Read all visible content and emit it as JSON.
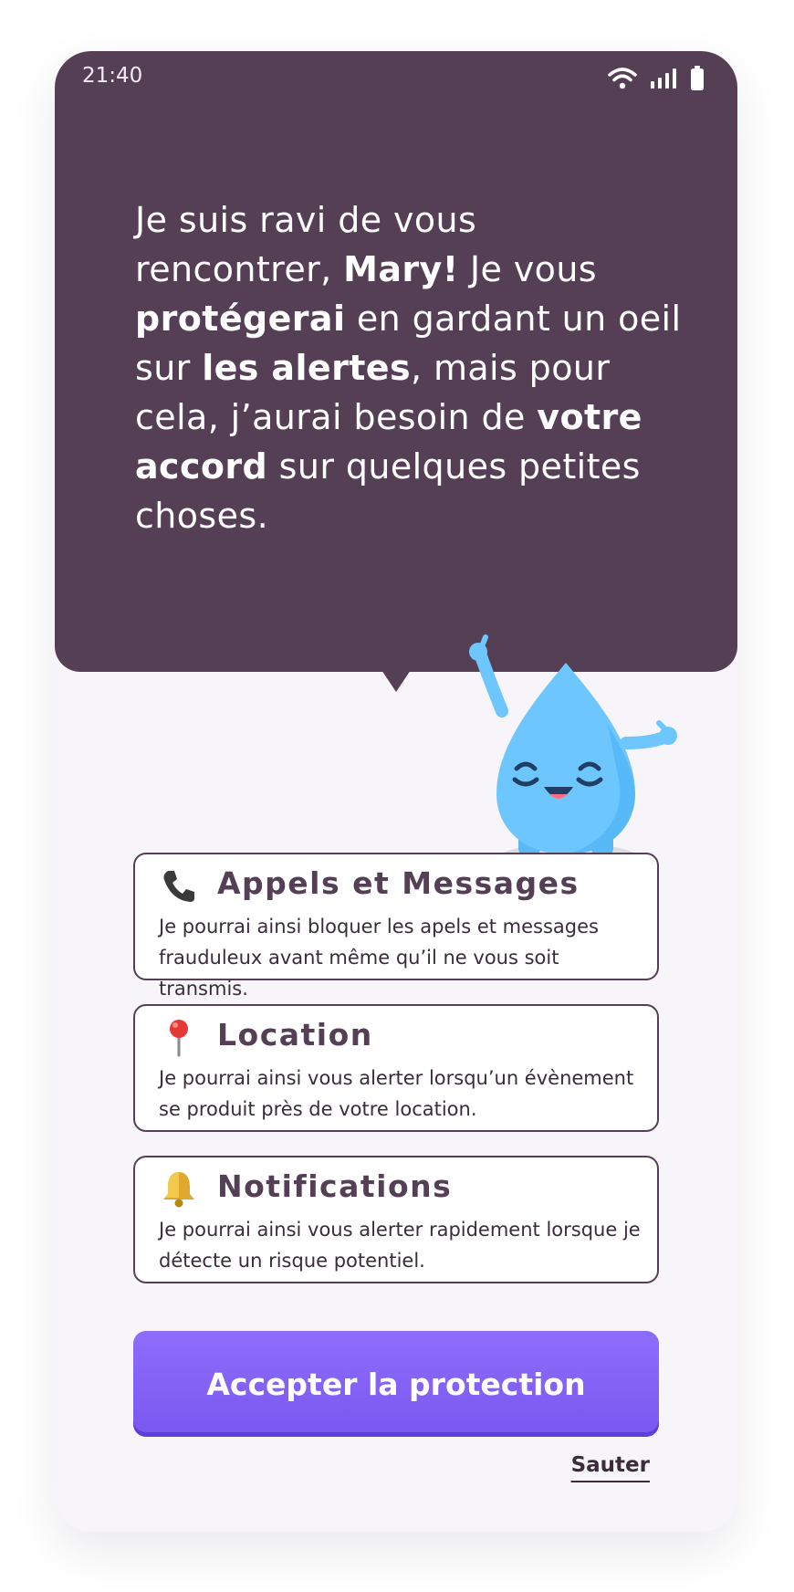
{
  "status_bar": {
    "time": "21:40",
    "icons": [
      "wifi-icon",
      "signal-icon",
      "battery-icon"
    ]
  },
  "intro": {
    "p1": "Je suis ravi de vous rencontrer, ",
    "name": "Mary!",
    "p2": " Je vous ",
    "b1": "protégerai",
    "p3": " en gardant un oeil sur ",
    "b2": "les alertes",
    "p4": ", mais pour cela, j’aurai besoin de ",
    "b3": "votre accord",
    "p5": " sur quelques petites choses."
  },
  "permissions": [
    {
      "icon": "phone-icon",
      "title": "Appels et Messages",
      "description": "Je pourrai ainsi bloquer les apels et messages frauduleux avant même qu’il ne vous soit transmis."
    },
    {
      "icon": "pin-icon",
      "title": "Location",
      "description": "Je pourrai ainsi vous alerter lorsqu’un évènement se produit près de votre location."
    },
    {
      "icon": "bell-icon",
      "title": "Notifications",
      "description": "Je pourrai ainsi vous alerter rapidement lorsque je détecte un risque potentiel."
    }
  ],
  "actions": {
    "accept_label": "Accepter la protection",
    "skip_label": "Sauter"
  },
  "colors": {
    "bubble": "#553f55",
    "background": "#f8f5fa",
    "accent": "#7a58f0",
    "mascot": "#6ec6ff"
  }
}
